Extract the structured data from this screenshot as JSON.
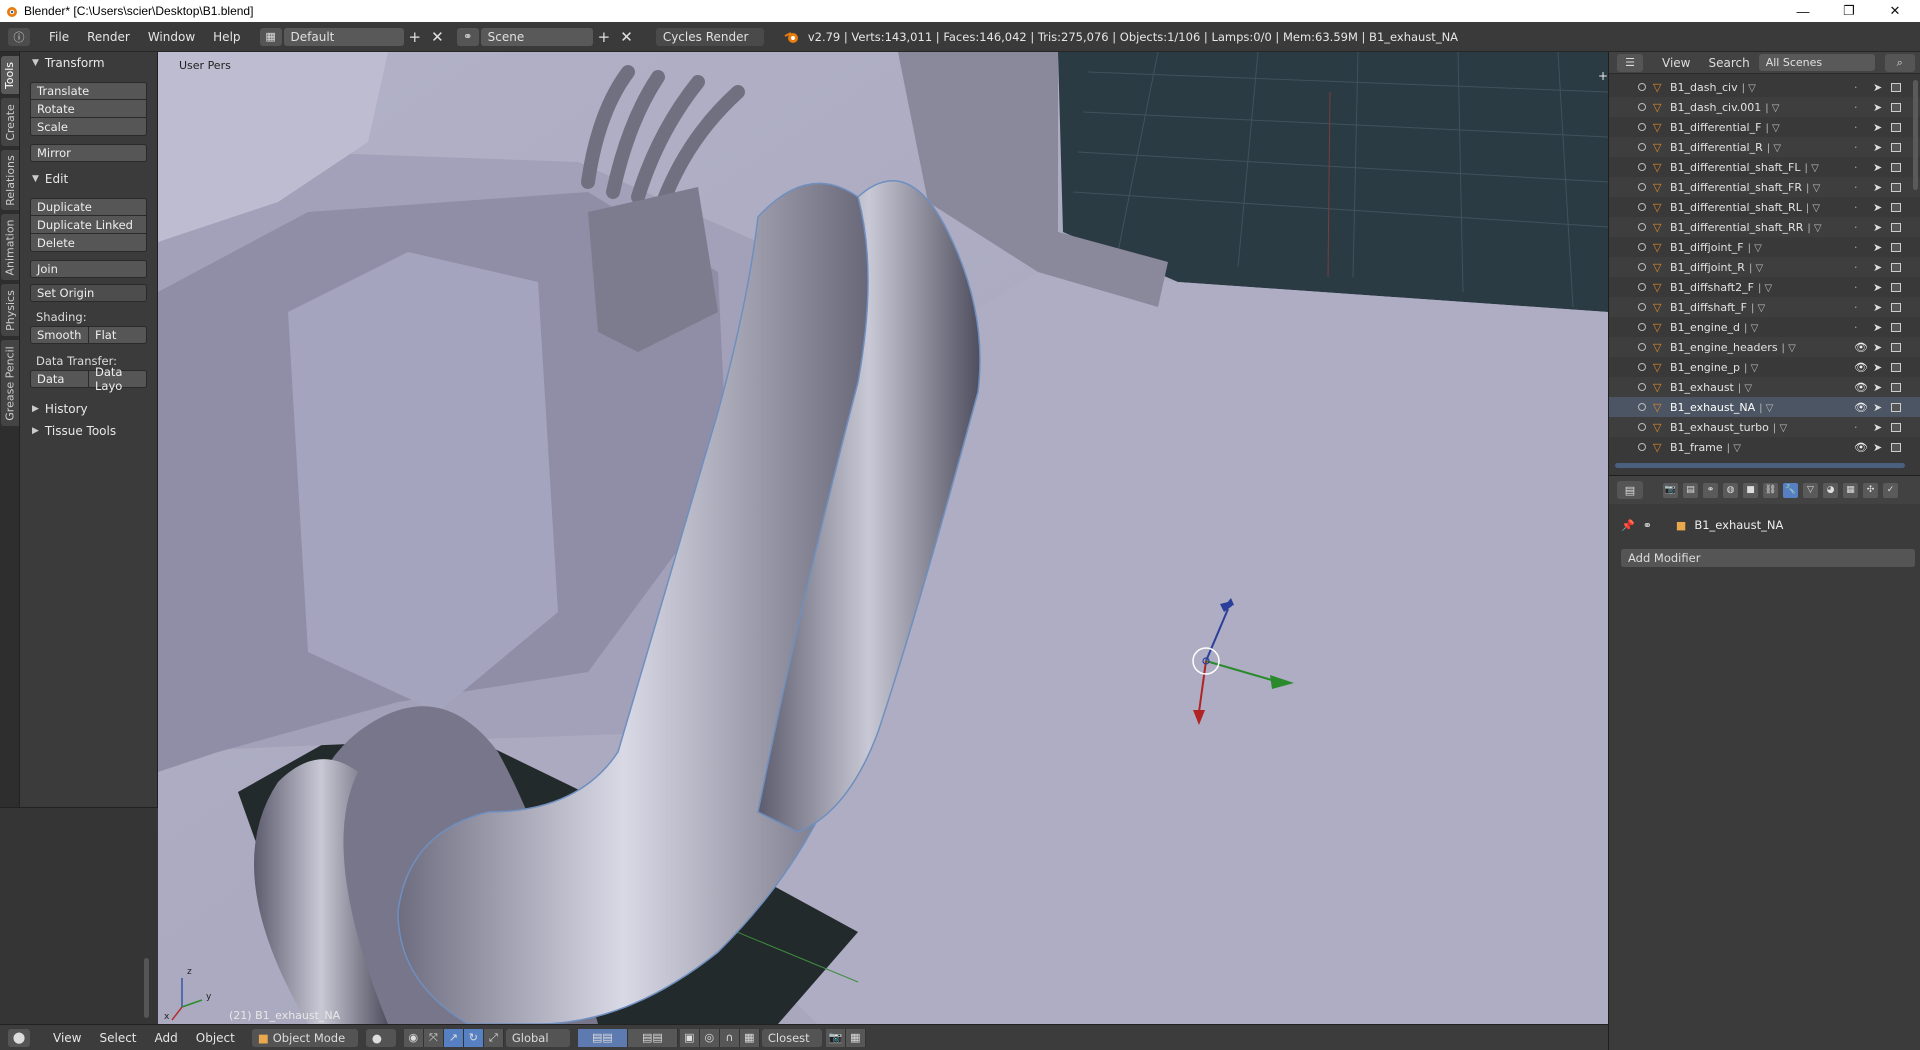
{
  "window": {
    "title": "Blender* [C:\\Users\\scier\\Desktop\\B1.blend]",
    "minimize": "—",
    "restore": "❐",
    "close": "✕"
  },
  "info_header": {
    "menus": [
      "File",
      "Render",
      "Window",
      "Help"
    ],
    "screen_layout": "Default",
    "scene": "Scene",
    "render_engine": "Cycles Render",
    "stats": "v2.79 | Verts:143,011 | Faces:146,042 | Tris:275,076 | Objects:1/106 | Lamps:0/0 | Mem:63.59M | B1_exhaust_NA"
  },
  "tool_tabs": [
    "Tools",
    "Create",
    "Relations",
    "Animation",
    "Physics",
    "Grease Pencil"
  ],
  "tool_shelf": {
    "transform_title": "Transform",
    "translate": "Translate",
    "rotate": "Rotate",
    "scale": "Scale",
    "mirror": "Mirror",
    "edit_title": "Edit",
    "duplicate": "Duplicate",
    "duplicate_linked": "Duplicate Linked",
    "delete": "Delete",
    "join": "Join",
    "set_origin": "Set Origin",
    "shading_label": "Shading:",
    "smooth": "Smooth",
    "flat": "Flat",
    "data_transfer_label": "Data Transfer:",
    "data": "Data",
    "data_layout": "Data Layo",
    "history": "History",
    "tissue_tools": "Tissue Tools"
  },
  "viewport": {
    "view_label": "User Pers",
    "object_label": "(21) B1_exhaust_NA",
    "axis_x": "x",
    "axis_y": "y",
    "axis_z": "z"
  },
  "view3d_header": {
    "menus": [
      "View",
      "Select",
      "Add",
      "Object"
    ],
    "mode": "Object Mode",
    "orientation": "Global",
    "snap": "Closest"
  },
  "outliner": {
    "view": "View",
    "search": "Search",
    "filter": "All Scenes",
    "items": [
      {
        "name": "B1_dash_civ",
        "visible": false
      },
      {
        "name": "B1_dash_civ.001",
        "visible": false
      },
      {
        "name": "B1_differential_F",
        "visible": false
      },
      {
        "name": "B1_differential_R",
        "visible": false
      },
      {
        "name": "B1_differential_shaft_FL",
        "visible": false
      },
      {
        "name": "B1_differential_shaft_FR",
        "visible": false
      },
      {
        "name": "B1_differential_shaft_RL",
        "visible": false
      },
      {
        "name": "B1_differential_shaft_RR",
        "visible": false
      },
      {
        "name": "B1_diffjoint_F",
        "visible": false
      },
      {
        "name": "B1_diffjoint_R",
        "visible": false
      },
      {
        "name": "B1_diffshaft2_F",
        "visible": false
      },
      {
        "name": "B1_diffshaft_F",
        "visible": false
      },
      {
        "name": "B1_engine_d",
        "visible": false
      },
      {
        "name": "B1_engine_headers",
        "visible": true
      },
      {
        "name": "B1_engine_p",
        "visible": true
      },
      {
        "name": "B1_exhaust",
        "visible": true
      },
      {
        "name": "B1_exhaust_NA",
        "visible": true,
        "selected": true
      },
      {
        "name": "B1_exhaust_turbo",
        "visible": false
      },
      {
        "name": "B1_frame",
        "visible": true
      }
    ]
  },
  "properties": {
    "object_name": "B1_exhaust_NA",
    "add_modifier": "Add Modifier"
  }
}
